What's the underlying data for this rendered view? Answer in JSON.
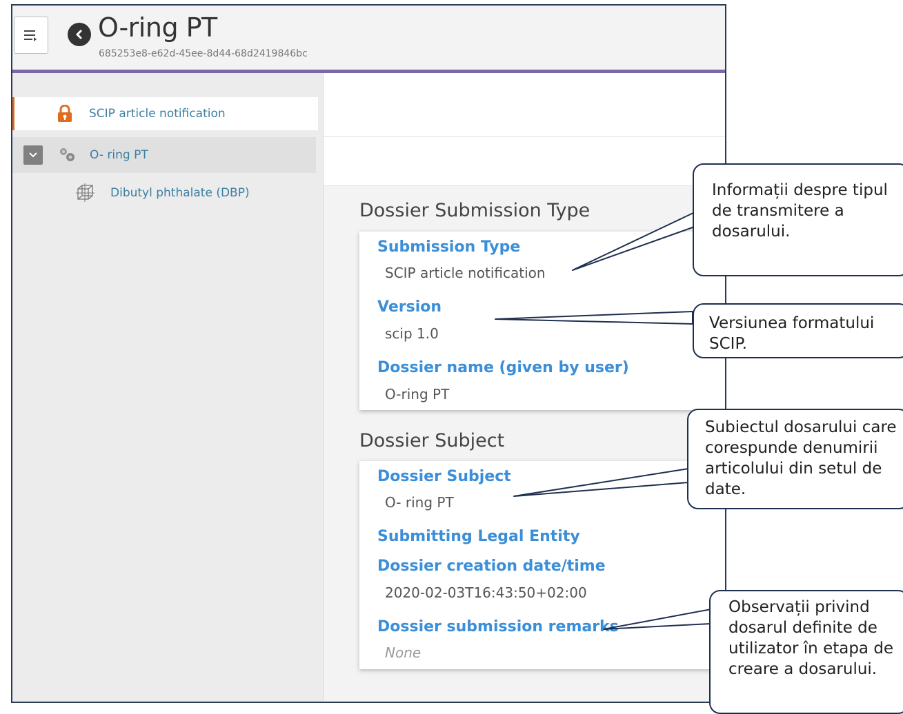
{
  "header": {
    "title": "O-ring PT",
    "uuid": "685253e8-e62d-45ee-8d44-68d2419846bc"
  },
  "sidebar": {
    "items": [
      {
        "label": "SCIP article notification",
        "icon": "lock-icon"
      },
      {
        "label": "O- ring PT",
        "icon": "article-icon"
      },
      {
        "label": "Dibutyl phthalate (DBP)",
        "icon": "substance-icon"
      }
    ]
  },
  "sections": {
    "submission_type": {
      "title": "Dossier Submission Type",
      "fields": [
        {
          "label": "Submission Type",
          "value": "SCIP article notification"
        },
        {
          "label": "Version",
          "value": "scip 1.0"
        },
        {
          "label": "Dossier name (given by user)",
          "value": "O-ring PT"
        }
      ]
    },
    "subject": {
      "title": "Dossier Subject",
      "fields": [
        {
          "label": "Dossier Subject",
          "value": "O- ring PT"
        },
        {
          "label": "Submitting Legal Entity",
          "value": ""
        },
        {
          "label": "Dossier creation date/time",
          "value": "2020-02-03T16:43:50+02:00"
        },
        {
          "label": "Dossier submission remarks",
          "value": "None"
        }
      ]
    }
  },
  "callouts": {
    "submission_type": "Informații despre tipul de transmitere a dosarului.",
    "version": "Versiunea formatului SCIP.",
    "subject": "Subiectul dosarului care corespunde denumirii articolului din setul de date.",
    "remarks": "Observații privind dosarul definite de utilizator în etapa de creare a dosarului."
  },
  "colors": {
    "accent_bar": "#7b68a8",
    "label_blue": "#3b8ed8",
    "link_teal": "#3a7fa0",
    "lock_orange": "#e06a20"
  }
}
